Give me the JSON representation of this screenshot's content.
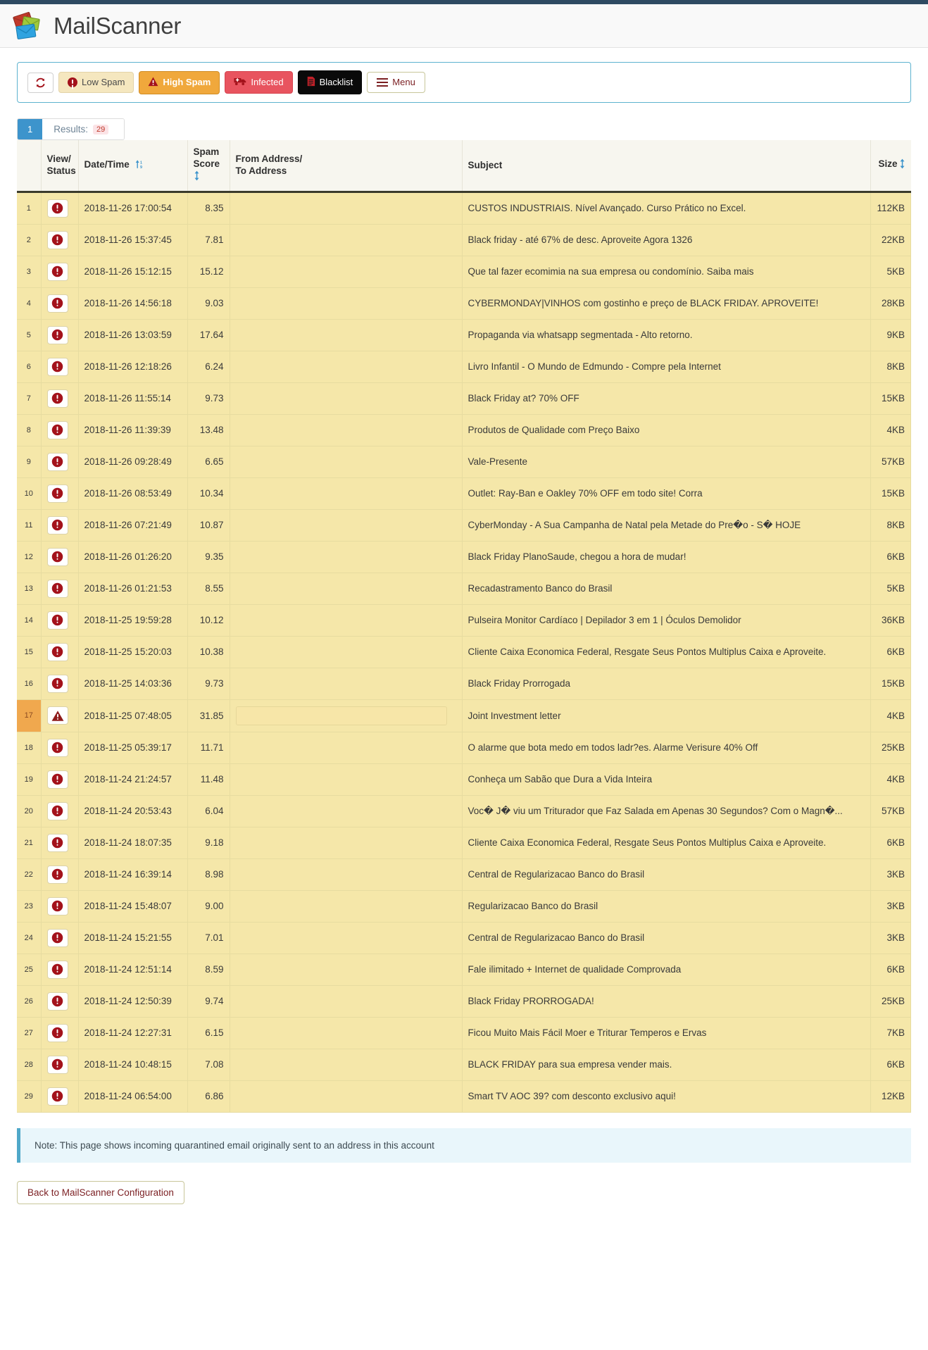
{
  "header": {
    "app_title": "MailScanner",
    "logo_icon": "envelopes-logo-icon"
  },
  "toolbar": {
    "refresh_label": "",
    "refresh_icon": "refresh-icon",
    "buttons": [
      {
        "label": "Low Spam",
        "icon": "exclamation-circle-icon",
        "state": "inactive"
      },
      {
        "label": "High Spam",
        "icon": "warning-triangle-icon",
        "state": "active"
      },
      {
        "label": "Infected",
        "icon": "ambulance-icon",
        "state": "inactive"
      },
      {
        "label": "Blacklist",
        "icon": "document-icon",
        "state": "inactive"
      }
    ],
    "menu_label": "Menu",
    "menu_icon": "hamburger-menu-icon"
  },
  "pagination": {
    "current_page": "1",
    "results_label": "Results:",
    "results_count": "29"
  },
  "table": {
    "headers": {
      "index": "",
      "view_status": "View/\nStatus",
      "view_status_line1": "View/",
      "view_status_line2": "Status",
      "date_time": "Date/Time",
      "date_sort_icon": "sort-numeric-icon",
      "spam_score_line1": "Spam",
      "spam_score_line2": "Score",
      "spam_sort_icon": "sort-updown-icon",
      "from_line1": "From Address/",
      "from_line2": "To Address",
      "subject": "Subject",
      "size": "Size",
      "size_sort_icon": "sort-updown-icon"
    },
    "rows": [
      {
        "idx": "1",
        "status_icon": "exclamation-circle-icon",
        "datetime": "2018-11-26 17:00:54",
        "score": "8.35",
        "from": "",
        "subject": "CUSTOS INDUSTRIAIS. Nível Avançado. Curso Prático no Excel.",
        "size": "112KB",
        "selected": false
      },
      {
        "idx": "2",
        "status_icon": "exclamation-circle-icon",
        "datetime": "2018-11-26 15:37:45",
        "score": "7.81",
        "from": "",
        "subject": "Black friday - até 67% de desc. Aproveite Agora 1326",
        "size": "22KB",
        "selected": false
      },
      {
        "idx": "3",
        "status_icon": "exclamation-circle-icon",
        "datetime": "2018-11-26 15:12:15",
        "score": "15.12",
        "from": "",
        "subject": "Que tal fazer ecomimia na sua empresa ou condomínio. Saiba mais",
        "size": "5KB",
        "selected": false
      },
      {
        "idx": "4",
        "status_icon": "exclamation-circle-icon",
        "datetime": "2018-11-26 14:56:18",
        "score": "9.03",
        "from": "",
        "subject": "CYBERMONDAY|VINHOS com gostinho e preço de BLACK FRIDAY. APROVEITE!",
        "size": "28KB",
        "selected": false
      },
      {
        "idx": "5",
        "status_icon": "exclamation-circle-icon",
        "datetime": "2018-11-26 13:03:59",
        "score": "17.64",
        "from": "",
        "subject": "Propaganda via whatsapp segmentada - Alto retorno.",
        "size": "9KB",
        "selected": false
      },
      {
        "idx": "6",
        "status_icon": "exclamation-circle-icon",
        "datetime": "2018-11-26 12:18:26",
        "score": "6.24",
        "from": "",
        "subject": "Livro Infantil - O Mundo de Edmundo - Compre pela Internet",
        "size": "8KB",
        "selected": false
      },
      {
        "idx": "7",
        "status_icon": "exclamation-circle-icon",
        "datetime": "2018-11-26 11:55:14",
        "score": "9.73",
        "from": "",
        "subject": "Black Friday at? 70% OFF",
        "size": "15KB",
        "selected": false
      },
      {
        "idx": "8",
        "status_icon": "exclamation-circle-icon",
        "datetime": "2018-11-26 11:39:39",
        "score": "13.48",
        "from": "",
        "subject": "Produtos de Qualidade com Preço Baixo",
        "size": "4KB",
        "selected": false
      },
      {
        "idx": "9",
        "status_icon": "exclamation-circle-icon",
        "datetime": "2018-11-26 09:28:49",
        "score": "6.65",
        "from": "",
        "subject": "Vale-Presente",
        "size": "57KB",
        "selected": false
      },
      {
        "idx": "10",
        "status_icon": "exclamation-circle-icon",
        "datetime": "2018-11-26 08:53:49",
        "score": "10.34",
        "from": "",
        "subject": "Outlet: Ray-Ban e Oakley 70% OFF em todo site! Corra",
        "size": "15KB",
        "selected": false
      },
      {
        "idx": "11",
        "status_icon": "exclamation-circle-icon",
        "datetime": "2018-11-26 07:21:49",
        "score": "10.87",
        "from": "",
        "subject": "CyberMonday - A Sua Campanha de Natal pela Metade do Pre�o - S� HOJE",
        "size": "8KB",
        "selected": false
      },
      {
        "idx": "12",
        "status_icon": "exclamation-circle-icon",
        "datetime": "2018-11-26 01:26:20",
        "score": "9.35",
        "from": "",
        "subject": "Black Friday PlanoSaude, chegou a hora de mudar!",
        "size": "6KB",
        "selected": false
      },
      {
        "idx": "13",
        "status_icon": "exclamation-circle-icon",
        "datetime": "2018-11-26 01:21:53",
        "score": "8.55",
        "from": "",
        "subject": "Recadastramento Banco do Brasil",
        "size": "5KB",
        "selected": false
      },
      {
        "idx": "14",
        "status_icon": "exclamation-circle-icon",
        "datetime": "2018-11-25 19:59:28",
        "score": "10.12",
        "from": "",
        "subject": "Pulseira Monitor Cardíaco | Depilador 3 em 1 | Óculos Demolidor",
        "size": "36KB",
        "selected": false
      },
      {
        "idx": "15",
        "status_icon": "exclamation-circle-icon",
        "datetime": "2018-11-25 15:20:03",
        "score": "10.38",
        "from": "",
        "subject": "Cliente Caixa Economica Federal, Resgate Seus Pontos Multiplus Caixa e Aproveite.",
        "size": "6KB",
        "selected": false
      },
      {
        "idx": "16",
        "status_icon": "exclamation-circle-icon",
        "datetime": "2018-11-25 14:03:36",
        "score": "9.73",
        "from": "",
        "subject": "Black Friday Prorrogada",
        "size": "15KB",
        "selected": false
      },
      {
        "idx": "17",
        "status_icon": "warning-triangle-icon",
        "datetime": "2018-11-25 07:48:05",
        "score": "31.85",
        "from": "",
        "subject": "Joint Investment letter",
        "size": "4KB",
        "selected": true
      },
      {
        "idx": "18",
        "status_icon": "exclamation-circle-icon",
        "datetime": "2018-11-25 05:39:17",
        "score": "11.71",
        "from": "",
        "subject": "O alarme que bota medo em todos ladr?es. Alarme Verisure 40% Off",
        "size": "25KB",
        "selected": false
      },
      {
        "idx": "19",
        "status_icon": "exclamation-circle-icon",
        "datetime": "2018-11-24 21:24:57",
        "score": "11.48",
        "from": "",
        "subject": "Conheça um Sabão que Dura a Vida Inteira",
        "size": "4KB",
        "selected": false
      },
      {
        "idx": "20",
        "status_icon": "exclamation-circle-icon",
        "datetime": "2018-11-24 20:53:43",
        "score": "6.04",
        "from": "",
        "subject": "Voc� J� viu um Triturador que Faz Salada em Apenas 30 Segundos? Com o Magn�...",
        "size": "57KB",
        "selected": false
      },
      {
        "idx": "21",
        "status_icon": "exclamation-circle-icon",
        "datetime": "2018-11-24 18:07:35",
        "score": "9.18",
        "from": "",
        "subject": "Cliente Caixa Economica Federal, Resgate Seus Pontos Multiplus Caixa e Aproveite.",
        "size": "6KB",
        "selected": false
      },
      {
        "idx": "22",
        "status_icon": "exclamation-circle-icon",
        "datetime": "2018-11-24 16:39:14",
        "score": "8.98",
        "from": "",
        "subject": "Central de Regularizacao Banco do Brasil",
        "size": "3KB",
        "selected": false
      },
      {
        "idx": "23",
        "status_icon": "exclamation-circle-icon",
        "datetime": "2018-11-24 15:48:07",
        "score": "9.00",
        "from": "",
        "subject": "Regularizacao Banco do Brasil",
        "size": "3KB",
        "selected": false
      },
      {
        "idx": "24",
        "status_icon": "exclamation-circle-icon",
        "datetime": "2018-11-24 15:21:55",
        "score": "7.01",
        "from": "",
        "subject": "Central de Regularizacao Banco do Brasil",
        "size": "3KB",
        "selected": false
      },
      {
        "idx": "25",
        "status_icon": "exclamation-circle-icon",
        "datetime": "2018-11-24 12:51:14",
        "score": "8.59",
        "from": "",
        "subject": "Fale ilimitado + Internet de qualidade Comprovada",
        "size": "6KB",
        "selected": false
      },
      {
        "idx": "26",
        "status_icon": "exclamation-circle-icon",
        "datetime": "2018-11-24 12:50:39",
        "score": "9.74",
        "from": "",
        "subject": "Black Friday PRORROGADA!",
        "size": "25KB",
        "selected": false
      },
      {
        "idx": "27",
        "status_icon": "exclamation-circle-icon",
        "datetime": "2018-11-24 12:27:31",
        "score": "6.15",
        "from": "",
        "subject": "Ficou Muito Mais Fácil Moer e Triturar Temperos e Ervas",
        "size": "7KB",
        "selected": false
      },
      {
        "idx": "28",
        "status_icon": "exclamation-circle-icon",
        "datetime": "2018-11-24 10:48:15",
        "score": "7.08",
        "from": "",
        "subject": "BLACK FRIDAY para sua empresa vender mais.",
        "size": "6KB",
        "selected": false
      },
      {
        "idx": "29",
        "status_icon": "exclamation-circle-icon",
        "datetime": "2018-11-24 06:54:00",
        "score": "6.86",
        "from": "",
        "subject": "Smart TV AOC 39? com desconto exclusivo aqui!",
        "size": "12KB",
        "selected": false
      }
    ]
  },
  "note": {
    "text": "Note: This page shows incoming quarantined email originally sent to an address in this account"
  },
  "footer": {
    "back_label": "Back to MailScanner Configuration"
  },
  "colors": {
    "accent_blue": "#3d94cc",
    "row_bg": "#f5e7a9",
    "selected_row_bg": "#f0a84e",
    "high_spam": "#f0a83c",
    "infected": "#e8545f",
    "blacklist": "#0a0a0a",
    "brand_red": "#a3121b",
    "note_border": "#4fa8c9"
  }
}
